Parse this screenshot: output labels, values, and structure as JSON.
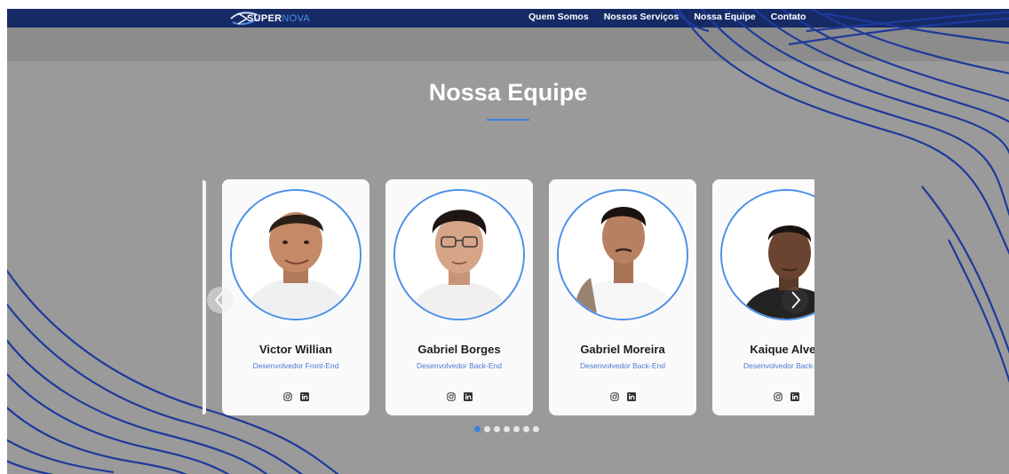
{
  "brand": {
    "name_part1": "SUPER",
    "name_part2": "NOVA",
    "accent_color": "#3b82e0",
    "nav_color": "#162a66"
  },
  "nav": {
    "links": [
      "Quem Somos",
      "Nossos Serviços",
      "Nossa Equipe",
      "Contato"
    ]
  },
  "section": {
    "title": "Nossa Equipe"
  },
  "team": [
    {
      "name": "Victor Willian",
      "role": "Desenvolvedor Front-End",
      "socials": [
        "instagram-icon",
        "linkedin-icon"
      ]
    },
    {
      "name": "Gabriel Borges",
      "role": "Desenvolvedor Back-End",
      "socials": [
        "instagram-icon",
        "linkedin-icon"
      ]
    },
    {
      "name": "Gabriel Moreira",
      "role": "Desenvolvedor Back-End",
      "socials": [
        "instagram-icon",
        "linkedin-icon"
      ]
    },
    {
      "name": "Kaique Alves",
      "role": "Desenvolvedor Back-End",
      "socials": [
        "instagram-icon",
        "linkedin-icon"
      ]
    }
  ],
  "carousel": {
    "pages": 7,
    "active_page": 1,
    "prev_icon": "chevron-left-icon",
    "next_icon": "chevron-right-icon"
  }
}
